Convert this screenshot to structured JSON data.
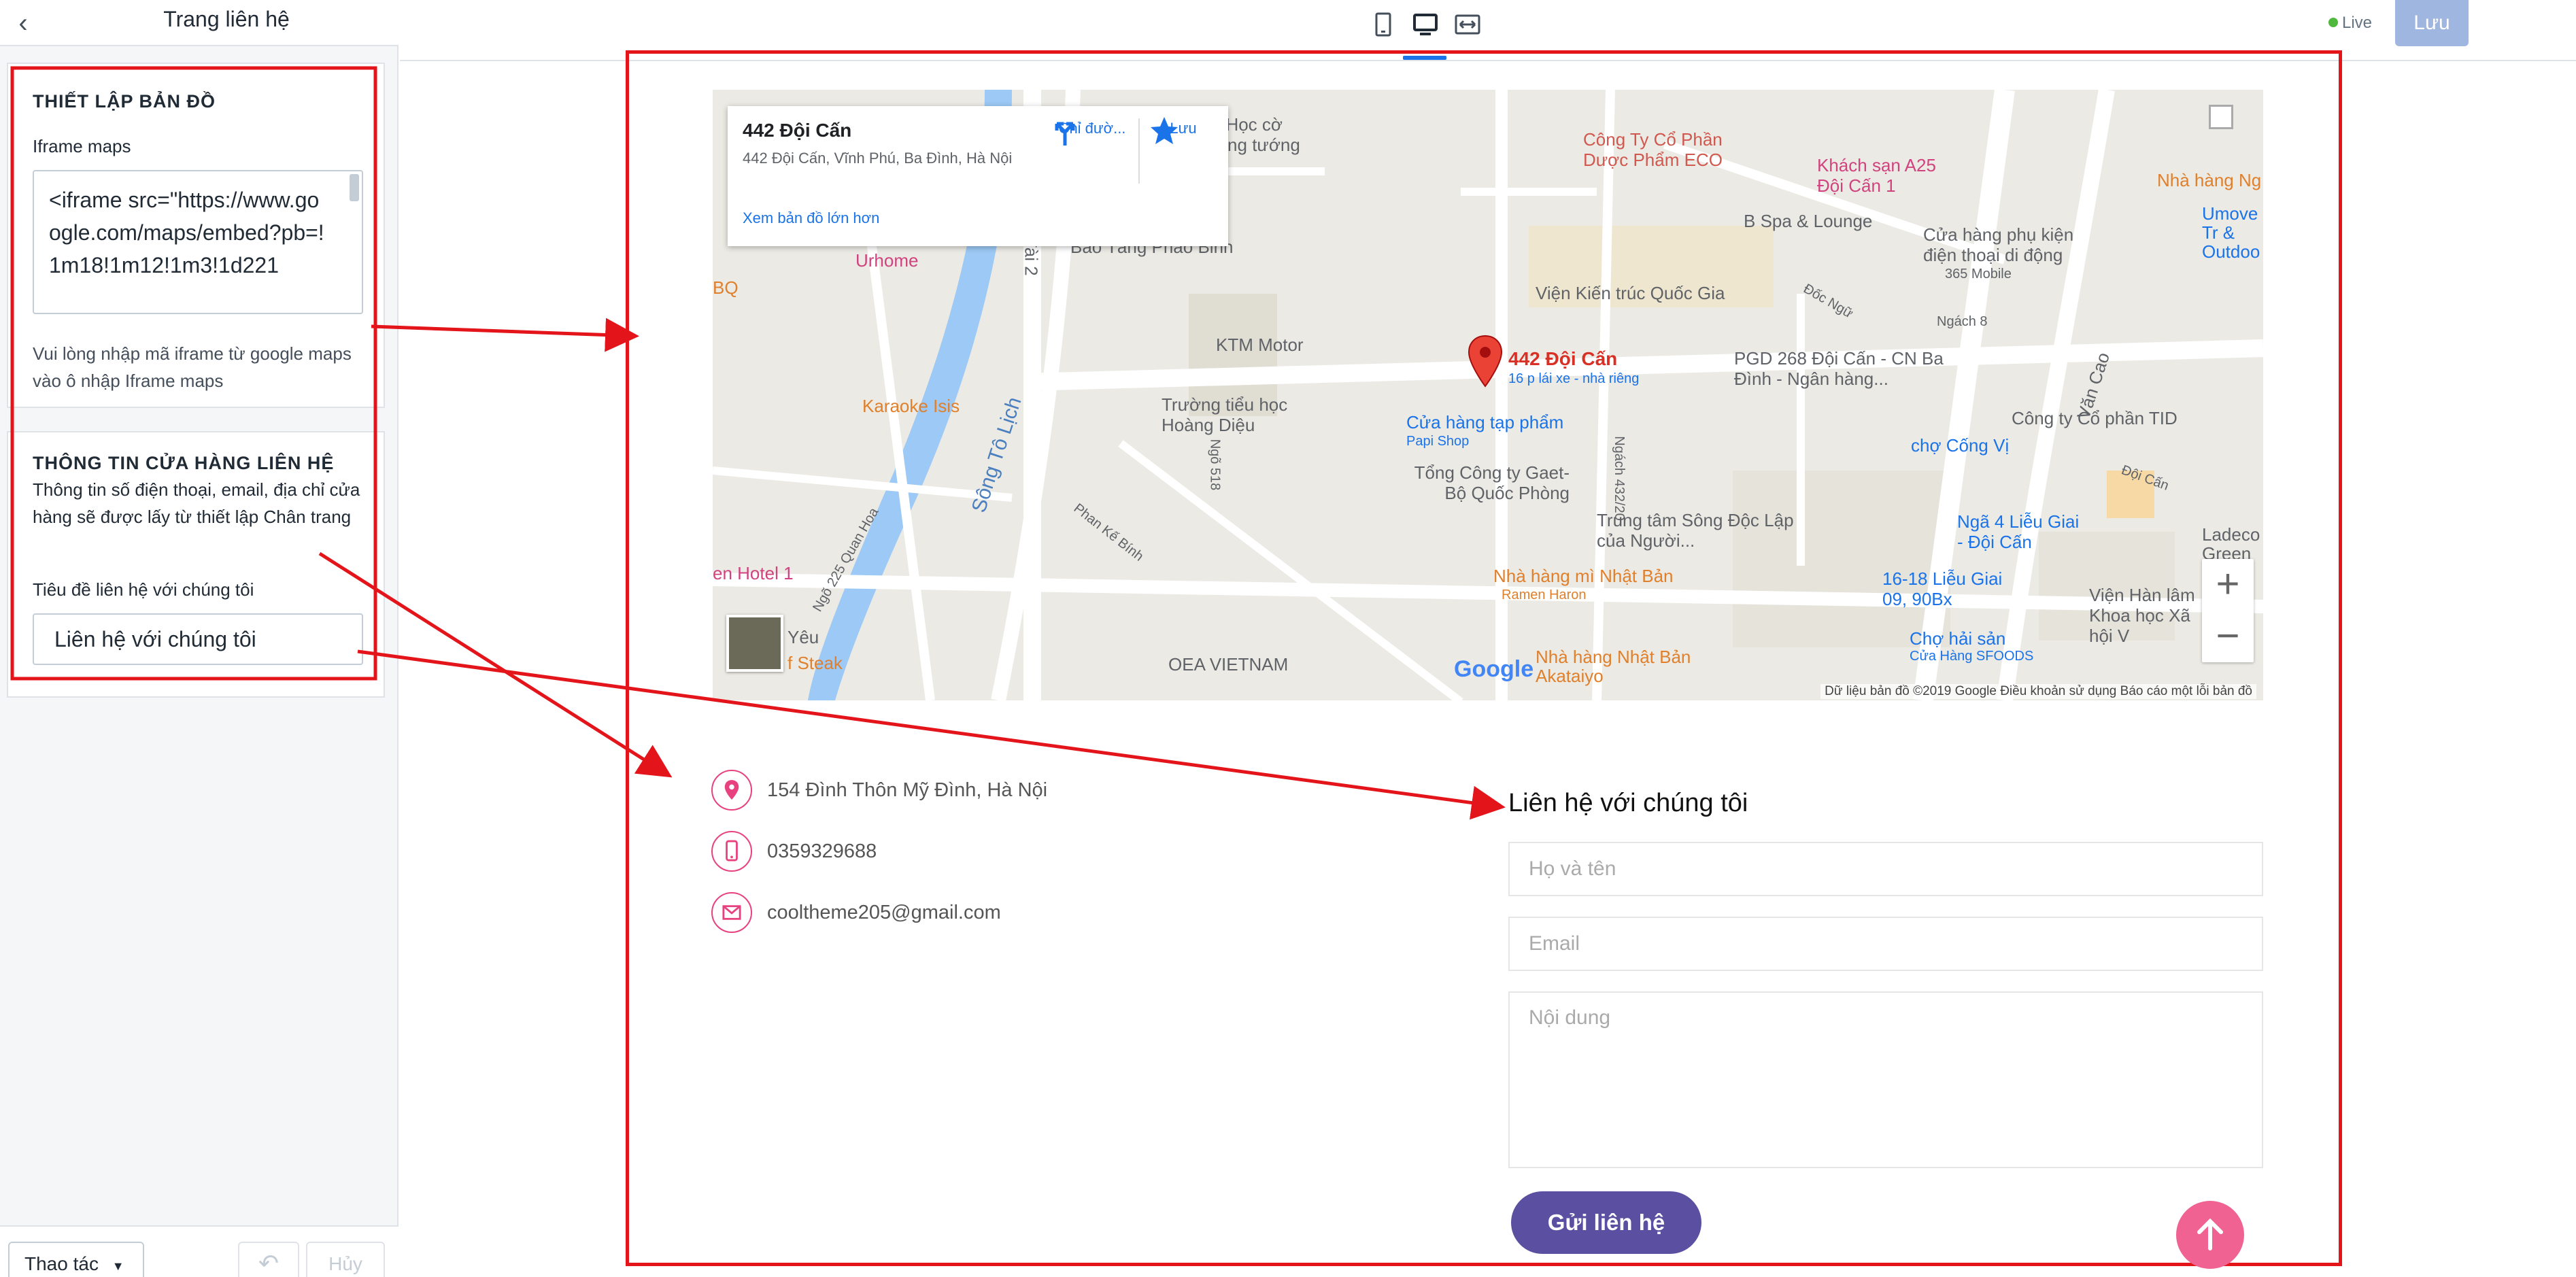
{
  "sidebar": {
    "title": "Trang liên hệ",
    "map_panel": {
      "heading": "THIẾT LẬP BẢN ĐỒ",
      "iframe_label": "Iframe maps",
      "iframe_value": "<iframe src=\"https://www.google.com/maps/embed?pb=!1m18!1m12!1m3!1d221",
      "help": "Vui lòng nhập mã iframe từ google maps vào ô nhập Iframe maps"
    },
    "info_panel": {
      "heading": "THÔNG TIN CỬA HÀNG LIÊN HỆ",
      "description": "Thông tin số điện thoại, email, địa chỉ cửa hàng sẽ được lấy từ thiết lập Chân trang",
      "title_label": "Tiêu đề liên hệ với chúng tôi",
      "title_value": "Liên hệ với chúng tôi"
    },
    "footer": {
      "actions_label": "Thao tác",
      "undo_icon": "↶",
      "cancel_label": "Hủy"
    }
  },
  "topbar": {
    "live_label": "Live",
    "save_label": "Lưu",
    "colors": {
      "live": "#50b83c",
      "active": "#1a73e8"
    }
  },
  "map": {
    "card": {
      "title": "442 Đội Cấn",
      "address": "442 Đội Cấn, Vĩnh Phú, Ba Đình, Hà Nội",
      "directions_label": "Chỉ đườ...",
      "save_label": "Lưu",
      "larger_map_link": "Xem bản đồ lớn hơn"
    },
    "pin_label": "442 Đội Cấn",
    "pin_sublabel": "16 p lái xe - nhà riêng",
    "labels": [
      "Sông Tô Lịch",
      "KTM Motor",
      "Trường tiểu học Hoàng Diệu",
      "Cửa hàng tạp phẩm",
      "Papi Shop",
      "Viện Kiến trúc Quốc Gia",
      "Công Ty Cổ Phần Dược Phẩm ECO",
      "Khách sạn A25 Đội Cấn 1",
      "B Spa & Lounge",
      "Cửa hàng phụ kiện điện thoại di động",
      "365 Mobile",
      "PGD 268 Đội Cấn - CN Ba Đình - Ngân hàng...",
      "Công ty Cổ phần TID",
      "chợ Cống Vị",
      "Tổng Công ty Gaet-Bộ Quốc Phòng",
      "Trung tâm Sông Độc Lập của Người...",
      "Nhà hàng mì Nhật Bản",
      "Ramen Haron",
      "Nhà hàng Nhật Bản Akataiyo",
      "OEA VIETNAM",
      "Karaoke Isis",
      "Urhome",
      "Bảo Tàng Pháo Binh",
      "Ngã 4 Liễu Giai - Đội Cấn",
      "16-18 Liễu Giai 09, 90Bx",
      "Chợ hải sản",
      "Cửa Hàng SFOODS",
      "Viện Hàn lâm Khoa học Xã hội V",
      "Ladeco Green",
      "Umove Tr & Outdoo",
      "Nhà hàng Ng",
      "Văn Cao",
      "Đội Cấn",
      "Ngõ 225 Quan Hoa",
      "Phan Kế Bính",
      "Ngõ 518",
      "Ngách 432/20",
      "Ngách 8",
      "Đốc Ngữ",
      "en Hotel 1",
      "BQ",
      "Yêu",
      "f Steak",
      "đài 2",
      "ĩ Học cờ",
      "ờng tướng",
      "ới"
    ],
    "attribution": "Dữ liệu bản đồ ©2019 Google    Điều khoản sử dụng    Báo cáo một lỗi bản đồ",
    "google_logo": "Google"
  },
  "contact": {
    "address": "154 Đình Thôn Mỹ Đình, Hà Nội",
    "phone": "0359329688",
    "email": "cooltheme205@gmail.com",
    "icon_color": "#e8417f"
  },
  "form": {
    "title": "Liên hệ với chúng tôi",
    "name_placeholder": "Họ và tên",
    "email_placeholder": "Email",
    "message_placeholder": "Nội dung",
    "submit_label": "Gửi liên hệ",
    "submit_color": "#5a4fa0",
    "scroll_top_color": "#f06292"
  },
  "annotation_color": "#e4141b"
}
